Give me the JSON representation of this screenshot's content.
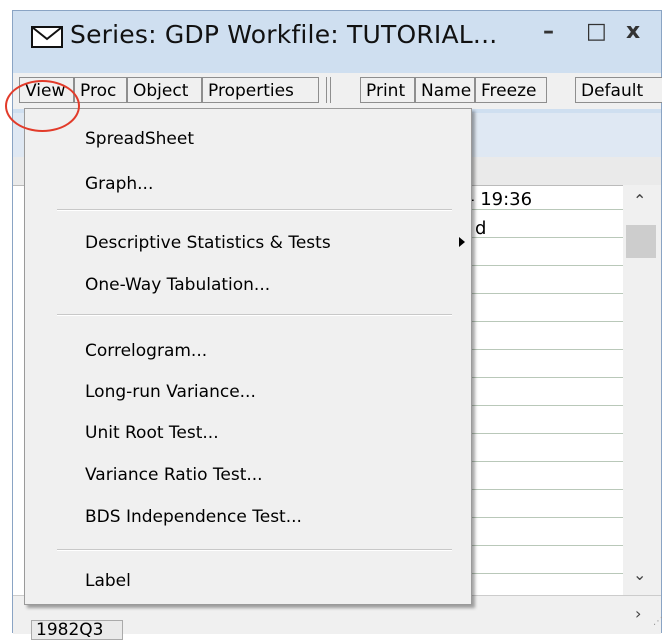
{
  "window": {
    "title": "Series: GDP   Workfile: TUTORIAL...",
    "controls": {
      "minimize": "–",
      "maximize": "□",
      "close": "x"
    }
  },
  "toolbar": {
    "view": "View",
    "proc": "Proc",
    "object": "Object",
    "properties": "Properties",
    "print": "Print",
    "name": "Name",
    "freeze": "Freeze",
    "default": "Default"
  },
  "sheet": {
    "visible_cell_1": "- 19:36",
    "visible_cell_2": "d",
    "row_label": "1982Q3"
  },
  "view_menu": {
    "items": [
      "SpreadSheet",
      "Graph...",
      "Descriptive Statistics & Tests",
      "One-Way Tabulation...",
      "Correlogram...",
      "Long-run Variance...",
      "Unit Root Test...",
      "Variance Ratio Test...",
      "BDS Independence Test...",
      "Label"
    ]
  },
  "icons": {
    "title": "envelope-icon",
    "submenu": "submenu-arrow-icon"
  },
  "colors": {
    "titlebar": "#cfdff0",
    "highlight": "#e23b2a",
    "menu_bg": "#f0f0f0"
  }
}
